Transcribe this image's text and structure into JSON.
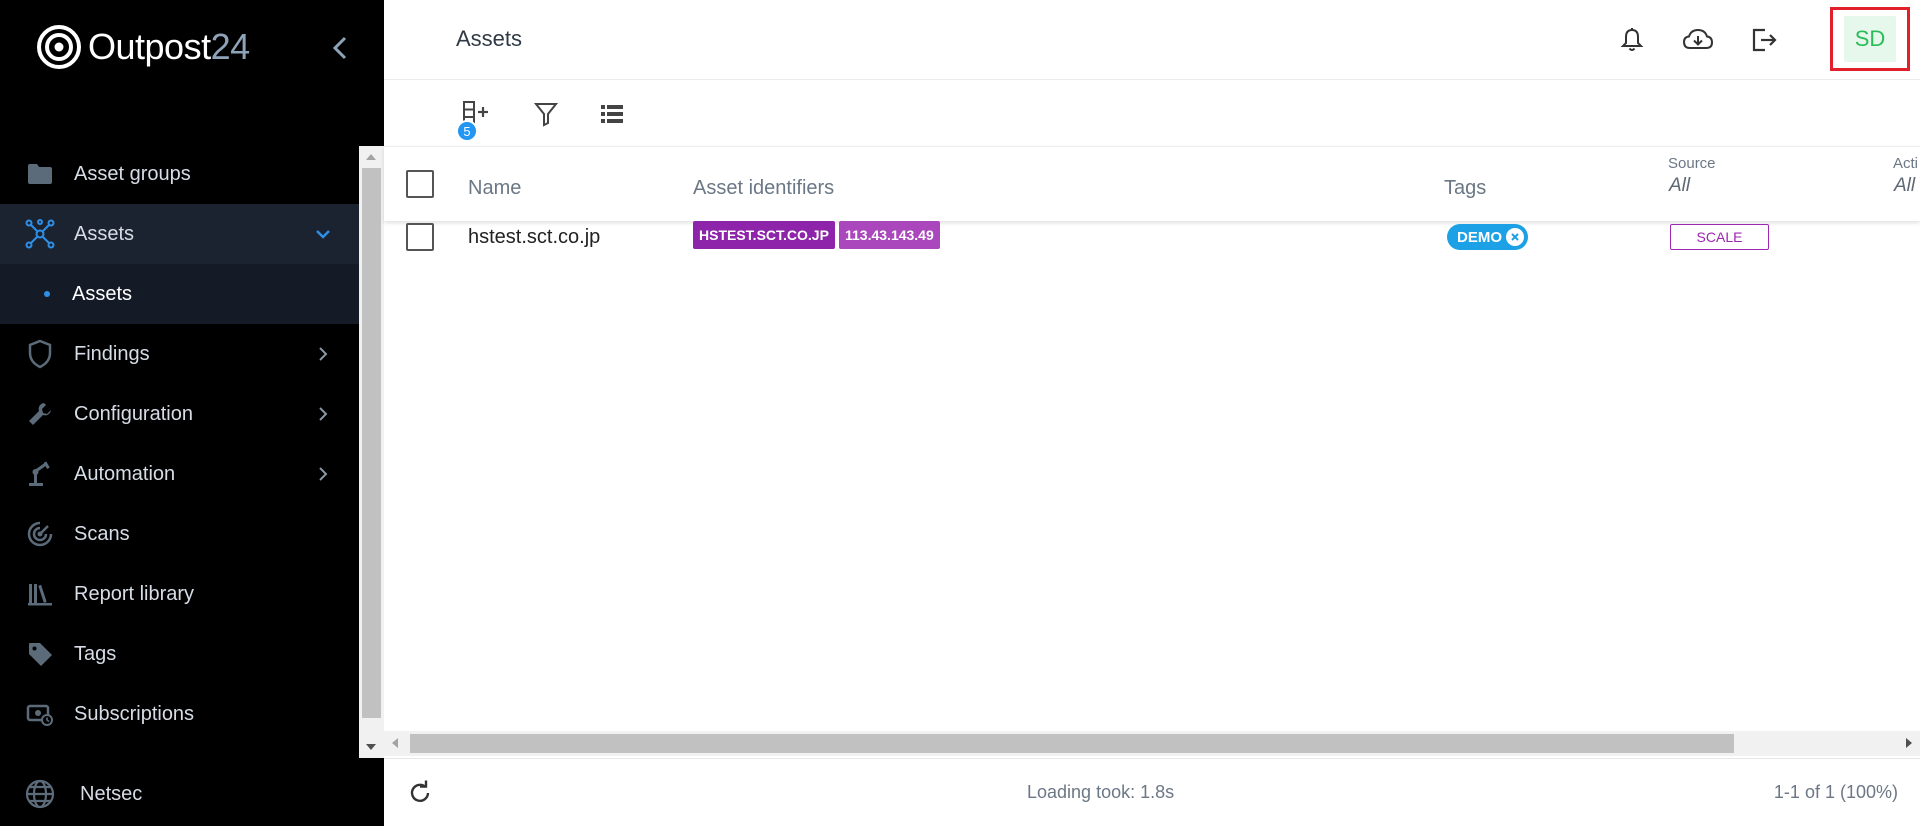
{
  "brand": {
    "name_main": "Outpost",
    "name_suffix": "24"
  },
  "sidebar": {
    "items": [
      {
        "label": "Asset groups",
        "icon": "folder-icon"
      },
      {
        "label": "Assets",
        "icon": "network-icon",
        "expanded": true
      },
      {
        "label": "Assets",
        "sub": true
      },
      {
        "label": "Findings",
        "icon": "shield-icon"
      },
      {
        "label": "Configuration",
        "icon": "wrench-icon"
      },
      {
        "label": "Automation",
        "icon": "robot-arm-icon"
      },
      {
        "label": "Scans",
        "icon": "radar-icon"
      },
      {
        "label": "Report library",
        "icon": "library-icon"
      },
      {
        "label": "Tags",
        "icon": "tag-icon"
      },
      {
        "label": "Subscriptions",
        "icon": "subscription-icon"
      }
    ],
    "bottom": {
      "label": "Netsec",
      "icon": "globe-icon"
    }
  },
  "header": {
    "title": "Assets",
    "avatar_initials": "SD"
  },
  "toolbar": {
    "column_badge": "5"
  },
  "table": {
    "columns": {
      "name": "Name",
      "identifiers": "Asset identifiers",
      "tags": "Tags",
      "source": "Source",
      "source_filter": "All",
      "actions": "Acti",
      "actions_filter": "All"
    },
    "rows": [
      {
        "name": "hstest.sct.co.jp",
        "identifiers": [
          "HSTEST.SCT.CO.JP",
          "113.43.143.49"
        ],
        "tag": "DEMO",
        "source": "SCALE"
      }
    ]
  },
  "footer": {
    "loading": "Loading took: 1.8s",
    "count": "1-1 of 1 (100%)"
  },
  "colors": {
    "sidebar_bg": "#000000",
    "active_bg": "#1b2330",
    "accent_blue": "#2f8fe6",
    "identifier_chip_1": "#8e24aa",
    "identifier_chip_2": "#ab47bc",
    "tag_blue": "#1da1e6",
    "source_purple": "#9c27b0",
    "avatar_green": "#2bbd5a",
    "highlight_red": "#e0202a"
  }
}
